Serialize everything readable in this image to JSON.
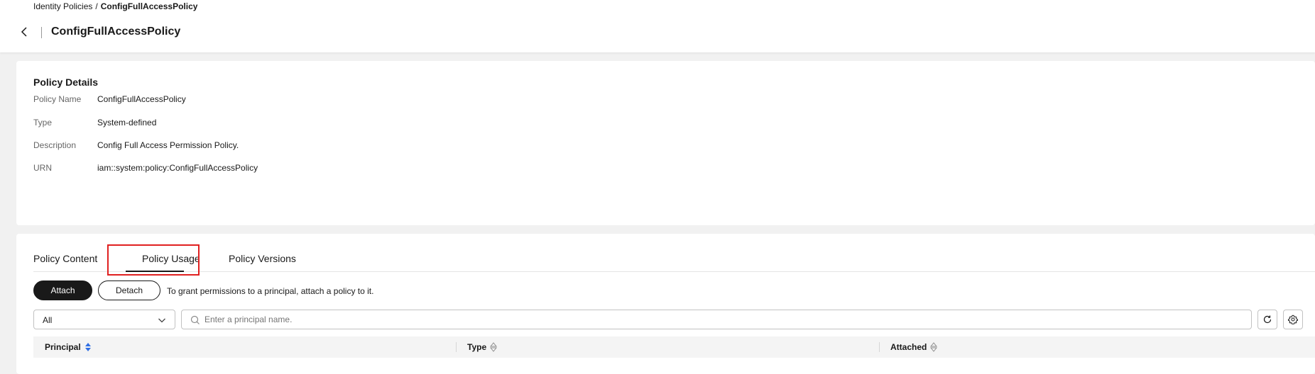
{
  "breadcrumb": {
    "parent": "Identity Policies",
    "separator": "/",
    "current": "ConfigFullAccessPolicy"
  },
  "page": {
    "title": "ConfigFullAccessPolicy"
  },
  "details": {
    "title": "Policy Details",
    "rows": [
      {
        "label": "Policy Name",
        "value": "ConfigFullAccessPolicy"
      },
      {
        "label": "Type",
        "value": "System-defined"
      },
      {
        "label": "Description",
        "value": "Config Full Access Permission Policy."
      },
      {
        "label": "URN",
        "value": "iam::system:policy:ConfigFullAccessPolicy"
      }
    ]
  },
  "tabs": [
    {
      "label": "Policy Content",
      "active": false
    },
    {
      "label": "Policy Usage",
      "active": true
    },
    {
      "label": "Policy Versions",
      "active": false
    }
  ],
  "toolbar": {
    "attach_label": "Attach",
    "detach_label": "Detach",
    "tip": "To grant permissions to a principal, attach a policy to it."
  },
  "filter": {
    "selected": "All"
  },
  "search": {
    "placeholder": "Enter a principal name."
  },
  "table": {
    "columns": [
      "Principal",
      "Type",
      "Attached"
    ]
  },
  "colors": {
    "highlight": "#e02020",
    "sort_active": "#2f6fe4",
    "primary_button": "#191919"
  }
}
